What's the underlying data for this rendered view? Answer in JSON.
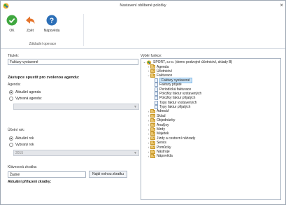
{
  "window": {
    "title": "Nastavení oblíbené položky",
    "close_label": "×"
  },
  "ribbon": {
    "ok_label": "OK",
    "back_label": "Zpět",
    "help_label": "Nápověda",
    "group_label": "Základní operace"
  },
  "form": {
    "title_label": "Titulek:",
    "title_value": "Faktury vystavené",
    "section_heading": "Zástupce spustit pro zvolenou agendu:",
    "agenda_label": "Agenda:",
    "agenda_current": "Aktuální agenda",
    "agenda_selected": "Vybraná agenda:",
    "agenda_combo_value": "",
    "year_label": "Účetní rok:",
    "year_current": "Aktuální rok",
    "year_selected": "Vybraný rok",
    "year_combo_value": "2015",
    "hotkey_label": "Klávesová zkratka:",
    "hotkey_value": "Žádné",
    "hotkey_button": "Najdi volnou zkratku",
    "current_hotkey_label": "Aktuální přiřazení zkratky:"
  },
  "functions": {
    "label": "Výběr funkce:",
    "root": "SPORT, s.r.o. (demo podvojné účetnictví, sklady B)",
    "top_folders_before": [
      "Agenda",
      "Účetnictví"
    ],
    "open_folder": "Fakturace",
    "children": [
      "Faktury vystavené",
      "Faktury přijaté",
      "Periodická fakturace",
      "Položky faktur vystavených",
      "Položky faktur přijatých",
      "Typy faktur vystavených",
      "Typy faktur přijatých"
    ],
    "selected_child": "Faktury vystavené",
    "top_folders_after": [
      "Adresář",
      "Sklad",
      "Objednávky",
      "Analýzy",
      "Mzdy",
      "Majetek",
      "Jízdy a cestovní náhrady",
      "Servis",
      "Pomůcky",
      "Nástroje",
      "Nápověda"
    ]
  },
  "colors": {
    "ok_green": "#3fa73f",
    "back_orange": "#e5742b",
    "help_blue": "#2c6fb7",
    "selection": "#cce4f7"
  }
}
